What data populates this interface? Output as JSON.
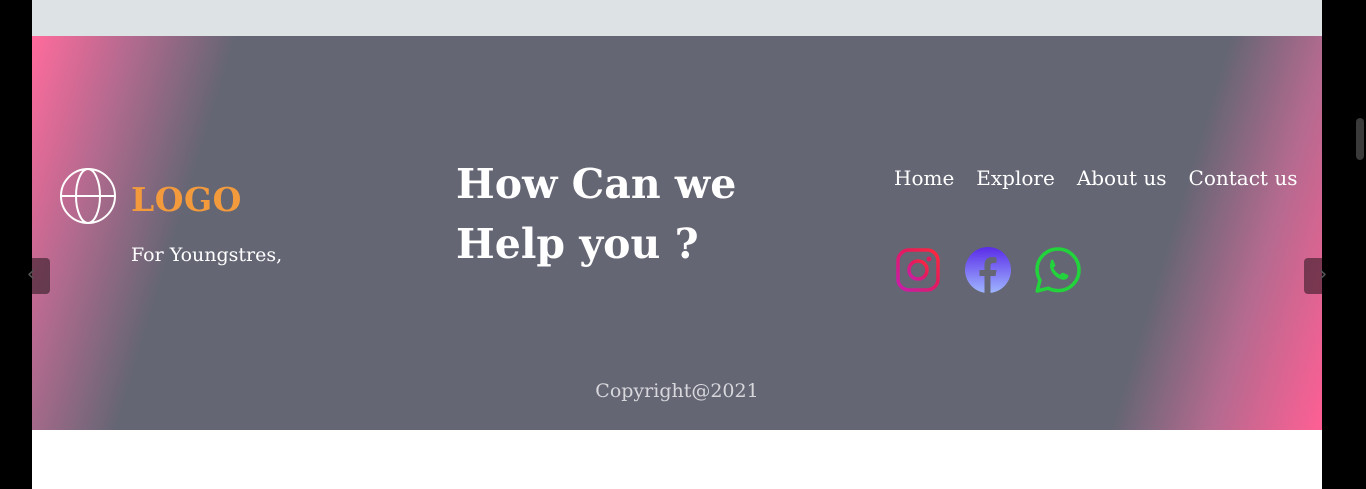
{
  "brand": {
    "logo_text": "LOGO",
    "tagline": "For Youngstres,",
    "logo_color": "#f39a3c",
    "globe_icon": "globe-icon"
  },
  "headline": {
    "line1": "How Can we",
    "line2": "Help you ?"
  },
  "nav": {
    "items": [
      {
        "label": "Home"
      },
      {
        "label": "Explore"
      },
      {
        "label": "About us"
      },
      {
        "label": "Contact us"
      }
    ]
  },
  "social": {
    "icons": [
      "instagram-icon",
      "facebook-icon",
      "whatsapp-icon"
    ]
  },
  "footer": {
    "copyright": "Copyright@2021",
    "background": "#646674",
    "accent_pink": "#ff6b9c"
  },
  "carousel": {
    "prev_glyph": "‹",
    "next_glyph": "›"
  }
}
